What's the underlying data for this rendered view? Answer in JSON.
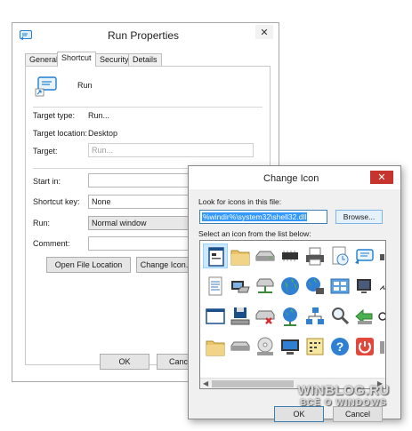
{
  "props_window": {
    "title": "Run Properties",
    "tabs": [
      "General",
      "Shortcut",
      "Security",
      "Details"
    ],
    "active_tab": "Shortcut",
    "shortcut_name": "Run",
    "fields": {
      "target_type_label": "Target type:",
      "target_type_value": "Run...",
      "target_location_label": "Target location:",
      "target_location_value": "Desktop",
      "target_label": "Target:",
      "target_value": "Run...",
      "start_in_label": "Start in:",
      "start_in_value": "",
      "shortcut_key_label": "Shortcut key:",
      "shortcut_key_value": "None",
      "run_label": "Run:",
      "run_value": "Normal window",
      "comment_label": "Comment:",
      "comment_value": ""
    },
    "buttons": {
      "open_file_location": "Open File Location",
      "change_icon": "Change Icon...",
      "ok": "OK",
      "cancel": "Cancel"
    }
  },
  "change_icon_dialog": {
    "title": "Change Icon",
    "look_for_label": "Look for icons in this file:",
    "path_value": "%windir%\\system32\\shell32.dll",
    "browse_label": "Browse...",
    "select_label": "Select an icon from the list below:",
    "icons": [
      [
        "document-window-icon",
        "folder-icon",
        "drive-icon",
        "chip-icon",
        "printer-icon",
        "clock-document-icon",
        "run-icon"
      ],
      [
        "text-document-icon",
        "computer-drives-icon",
        "network-drive-icon",
        "globe-icon",
        "network-globe-icon",
        "control-panel-icon",
        "monitor-icon"
      ],
      [
        "window-icon",
        "disk-tray-icon",
        "drive-error-icon",
        "globe-network-icon",
        "network-icon",
        "search-icon",
        "arrow-icon"
      ],
      [
        "folder-icon",
        "drive-icon",
        "cd-icon",
        "desktop-icon",
        "calendar-icon",
        "help-icon",
        "shutdown-icon"
      ]
    ],
    "buttons": {
      "ok": "OK",
      "cancel": "Cancel"
    }
  },
  "watermark": {
    "line1": "WINBLOG.RU",
    "line2": "ВСЁ О WINDOWS"
  },
  "colors": {
    "selection": "#3399ff",
    "close_button": "#c7342d",
    "icon_selected_bg": "#cce8ff",
    "run_icon_blue": "#1f7fd1"
  }
}
